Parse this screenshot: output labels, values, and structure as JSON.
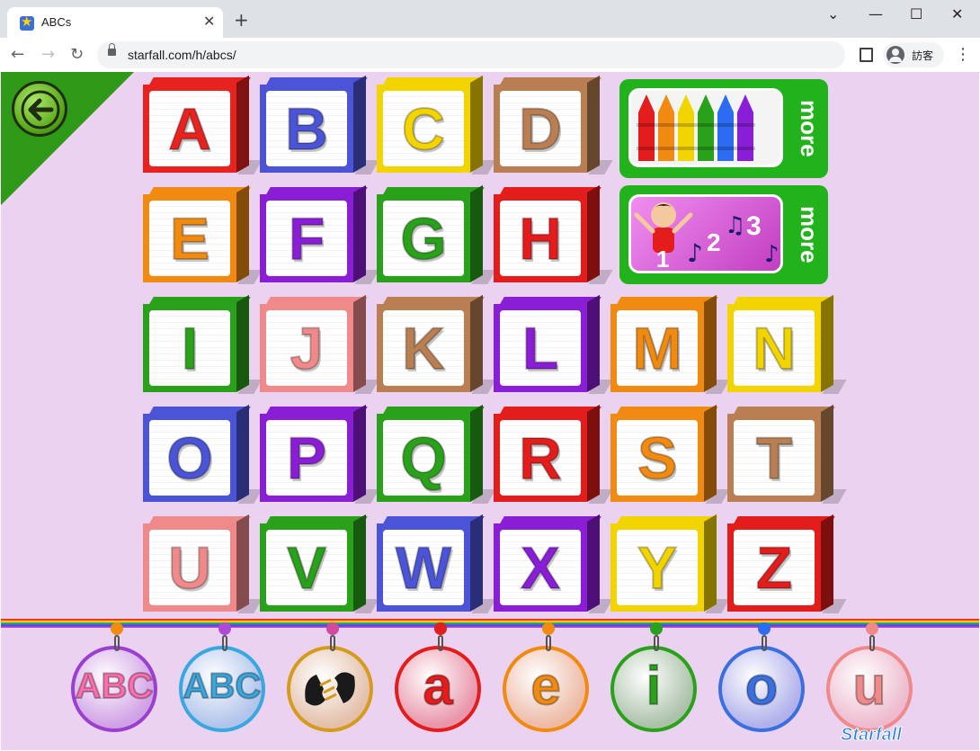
{
  "browser": {
    "tab_title": "ABCs",
    "tab_close": "✕",
    "new_tab": "+",
    "minimize": "—",
    "maximize": "☐",
    "close": "✕",
    "chevron": "⌄",
    "url": "starfall.com/h/abcs/",
    "profile_name": "訪客",
    "menu": "⋮"
  },
  "page": {
    "background": "#ecd2f1",
    "back_button": "back-arrow-icon",
    "blocks": [
      {
        "letter": "A",
        "color": "#e8231f"
      },
      {
        "letter": "B",
        "color": "#4b53d6"
      },
      {
        "letter": "C",
        "color": "#f2d500"
      },
      {
        "letter": "D",
        "color": "#b97f52"
      },
      {
        "letter": "E",
        "color": "#f08a10"
      },
      {
        "letter": "F",
        "color": "#8a1ed6"
      },
      {
        "letter": "G",
        "color": "#2aa11a"
      },
      {
        "letter": "H",
        "color": "#e31c1c"
      },
      {
        "letter": "I",
        "color": "#2aa11a"
      },
      {
        "letter": "J",
        "color": "#f08a8a"
      },
      {
        "letter": "K",
        "color": "#b97f52"
      },
      {
        "letter": "L",
        "color": "#8a1ed6"
      },
      {
        "letter": "M",
        "color": "#f08a10"
      },
      {
        "letter": "N",
        "color": "#f2d500"
      },
      {
        "letter": "O",
        "color": "#4b53d6"
      },
      {
        "letter": "P",
        "color": "#8a1ed6"
      },
      {
        "letter": "Q",
        "color": "#2aa11a"
      },
      {
        "letter": "R",
        "color": "#e31c1c"
      },
      {
        "letter": "S",
        "color": "#f08a10"
      },
      {
        "letter": "T",
        "color": "#b97f52"
      },
      {
        "letter": "U",
        "color": "#f08a8a"
      },
      {
        "letter": "V",
        "color": "#2aa11a"
      },
      {
        "letter": "W",
        "color": "#4b53d6"
      },
      {
        "letter": "X",
        "color": "#8a1ed6"
      },
      {
        "letter": "Y",
        "color": "#f2d500"
      },
      {
        "letter": "Z",
        "color": "#e31c1c"
      }
    ],
    "promos": [
      {
        "label": "more",
        "image": "crayons-icon"
      },
      {
        "label": "more",
        "image": "numbers-song-icon",
        "numbers": [
          "1",
          "2",
          "3"
        ]
      }
    ],
    "medals": [
      {
        "name": "unicorn-abc-medal",
        "letters": "ABC",
        "color": "#9a3fcf"
      },
      {
        "name": "abc-medal",
        "letters": "ABC",
        "color": "#3aa8e0"
      },
      {
        "name": "sign-language-medal",
        "letters": "",
        "color": "#d49b1c"
      },
      {
        "name": "vowel-a-medal",
        "letters": "a",
        "color": "#e31c1c"
      },
      {
        "name": "vowel-e-medal",
        "letters": "e",
        "color": "#f08a10"
      },
      {
        "name": "vowel-i-medal",
        "letters": "i",
        "color": "#2aa11a"
      },
      {
        "name": "vowel-o-medal",
        "letters": "o",
        "color": "#3a6fe0"
      },
      {
        "name": "vowel-u-medal",
        "letters": "u",
        "color": "#f08a8a"
      }
    ],
    "logo": "Starfall"
  }
}
